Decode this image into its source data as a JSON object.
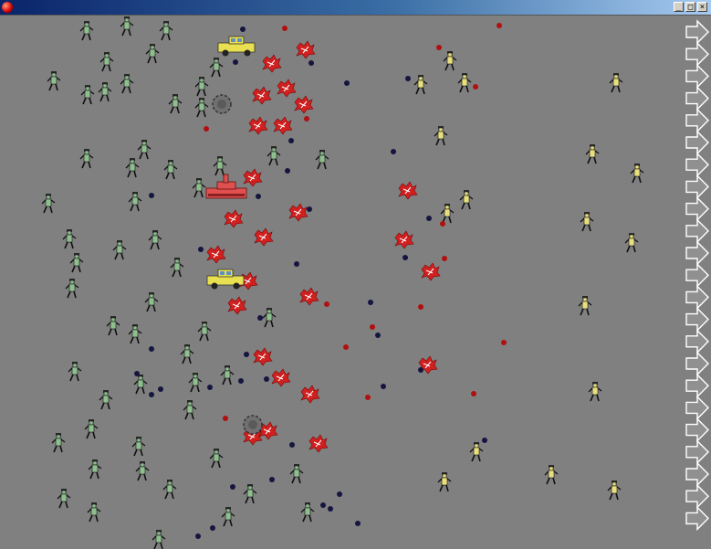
{
  "window": {
    "title": "",
    "controls": {
      "minimize": "_",
      "maximize": "□",
      "close": "×"
    }
  },
  "colors": {
    "background": "#808080",
    "allied_soldier": "#8fbf8f",
    "enemy_soldier": "#e8e080",
    "blood": "#d02020",
    "bomb": "#151540",
    "enemy_shot": "#b01010",
    "tank": "#e05050",
    "jeep": "#e8e050",
    "lane_arrow": "#ffffff"
  },
  "icons": {
    "allied": "soldier-green-icon",
    "enemy": "soldier-yellow-icon",
    "splat": "blood-splatter-icon",
    "jeep": "jeep-icon",
    "tank": "tank-icon",
    "crater": "crater-icon",
    "lane": "lane-arrow-icon"
  }
}
